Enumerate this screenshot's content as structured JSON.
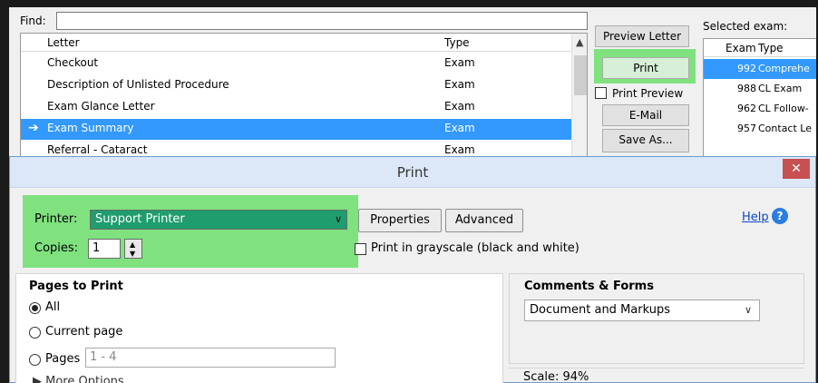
{
  "letters_window": {
    "find_label": "Find:",
    "find_value": "",
    "columns": {
      "letter": "Letter",
      "type": "Type"
    },
    "rows": [
      {
        "letter": "Checkout",
        "type": "Exam"
      },
      {
        "letter": "Description of Unlisted Procedure",
        "type": "Exam"
      },
      {
        "letter": "Exam Glance Letter",
        "type": "Exam"
      },
      {
        "letter": "Exam Summary",
        "type": "Exam",
        "selected": true
      },
      {
        "letter": "Referral - Cataract",
        "type": "Exam"
      }
    ],
    "buttons": {
      "preview_letter": "Preview Letter",
      "print": "Print",
      "print_preview": "Print Preview",
      "email": "E-Mail",
      "save_as": "Save As..."
    },
    "selected_exam_label": "Selected exam:",
    "exam_columns": {
      "exam": "Exam",
      "type": "Type"
    },
    "exams": [
      {
        "num": "992",
        "type": "Comprehe",
        "selected": true
      },
      {
        "num": "988",
        "type": "CL Exam"
      },
      {
        "num": "962",
        "type": "CL Follow-"
      },
      {
        "num": "957",
        "type": "Contact Le"
      }
    ]
  },
  "print_dialog": {
    "title": "Print",
    "close_icon": "close-icon",
    "printer_label": "Printer:",
    "printer_value": "Support Printer",
    "properties_label": "Properties",
    "advanced_label": "Advanced",
    "copies_label": "Copies:",
    "copies_value": "1",
    "grayscale_label": "Print in grayscale (black and white)",
    "help_label": "Help",
    "pages_to_print": {
      "title": "Pages to Print",
      "all": "All",
      "current_page": "Current page",
      "pages": "Pages",
      "pages_range": "1 - 4",
      "more_options": "More Options"
    },
    "comments_forms": {
      "title": "Comments & Forms",
      "value": "Document and Markups"
    },
    "scale_label": "Scale: 94%"
  },
  "colors": {
    "highlight": "#7fe27f",
    "selection": "#3399ff",
    "printer_select_bg": "#1f9d6e",
    "close_button": "#c75050"
  }
}
